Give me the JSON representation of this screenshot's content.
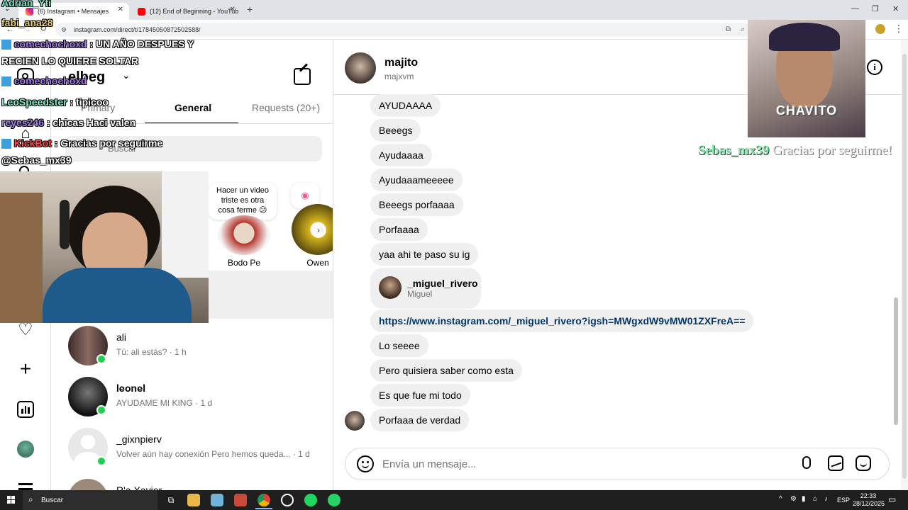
{
  "browser": {
    "tabs": [
      {
        "title": "(6) Instagram • Mensajes",
        "active": true
      },
      {
        "title": "(12) End of Beginning - YouTub",
        "active": false
      }
    ],
    "new_tab": "+",
    "url": "instagram.com/direct/t/17845050872502588/"
  },
  "inbox": {
    "username": "elbeg",
    "tabs": [
      "Primary",
      "General",
      "Requests (20+)"
    ],
    "search_placeholder": "Buscar",
    "notes": [
      {
        "note": "Hacer un video triste es otra cosa ferme 😕",
        "name": "Bodo Pe"
      },
      {
        "note": "",
        "name": "Owen"
      }
    ],
    "conversations": [
      {
        "name": "ali",
        "preview": "Tú: ali estás? · 1 h",
        "online": true
      },
      {
        "name": "𝐥𝐞𝐨𝐧𝐞𝐥",
        "preview": "AYUDAME MI KING · 1 d",
        "online": true
      },
      {
        "name": "_gixnpierv",
        "preview": "Volver aún hay conexión Pero hemos queda... · 1 d",
        "online": true
      },
      {
        "name": "R'a Xavier",
        "preview": "",
        "online": false
      }
    ]
  },
  "chat": {
    "name": "majito",
    "username": "majxvm",
    "messages": [
      "AYUDAAAA",
      "Beeegs",
      "Ayudaaaa",
      "Ayudaaameeeee",
      "Beeegs porfaaaa",
      "Porfaaaa",
      "yaa ahi te paso su ig"
    ],
    "shared_profile": {
      "username": "_miguel_rivero",
      "name": "Miguel"
    },
    "link": "https://www.instagram.com/_miguel_rivero?igsh=MWgxdW9vMW01ZXFreA==",
    "messages_after": [
      "Lo seeee",
      "Pero quisiera saber como esta",
      "Es que fue mi todo",
      "Porfaaa de verdad"
    ],
    "input_placeholder": "Envía un mensaje..."
  },
  "stream_overlay": {
    "chat_lines": [
      {
        "user": "Adrian_Yti",
        "text": ""
      },
      {
        "user": "fabi_ana28",
        "text": ""
      },
      {
        "user": "comechochoxd",
        "text": " : UN AÑO DESPUES Y"
      },
      {
        "user": "",
        "text": "RECIEN LO QUIERE SOLTAR"
      },
      {
        "user": "comechochoxd",
        "text": ""
      },
      {
        "user": "LeoSpeedster",
        "text": " : tipicoo"
      },
      {
        "user": "reyes246",
        "text": " : chicas Haci valen"
      },
      {
        "user": "KickBot",
        "text": " : Gracias por seguirme"
      },
      {
        "user": "",
        "text": "@Sebas_mx39"
      }
    ],
    "alert_user": "Sebas_mx39",
    "alert_text": "Gracias por seguirme!",
    "webcam_label": "CHAVITO"
  },
  "taskbar": {
    "search": "Buscar",
    "lang": "ESP",
    "time": "22:33",
    "date": "28/12/2025"
  },
  "colors": {
    "accent": "#0095f6",
    "online": "#1cd14f",
    "bubble": "#efefef",
    "link": "#00376b",
    "overlay_cyan": "#7ee8c8",
    "overlay_purple": "#a77ee8",
    "overlay_red": "#ff4d4d"
  }
}
